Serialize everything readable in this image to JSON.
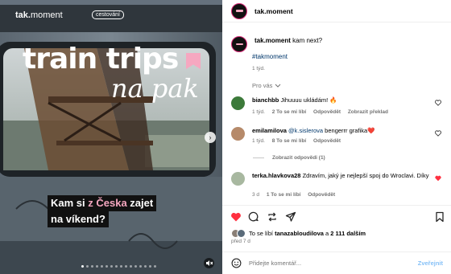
{
  "media": {
    "watermark_a": "tak.",
    "watermark_b": "moment",
    "tag": "cestování",
    "title_line1": "train trips",
    "title_line2": "na pak",
    "caption_part1": "Kam si ",
    "caption_highlight": "z Česka",
    "caption_part2": " zajet",
    "caption_line2": "na víkend?",
    "next_glyph": "›",
    "icons": [
      "bookmark-shape",
      "chevron-right-icon",
      "mute-icon"
    ]
  },
  "header": {
    "username": "tak.moment"
  },
  "post_caption": {
    "username": "tak.moment",
    "text": "kam next?",
    "hashtag": "#takmoment",
    "time": "1 týd."
  },
  "for_you": "Pro vás",
  "comments": [
    {
      "username": "bianchbb",
      "text": "Jihuuuu ukládám! 🔥",
      "time": "1 týd.",
      "likes": "2 To se mi líbí",
      "reply": "Odpovědět",
      "extra": "Zobrazit překlad",
      "liked": false
    },
    {
      "username": "emilamilova",
      "mention": "@k.sislerova",
      "text": " bengerrr grafika❤️",
      "time": "1 týd.",
      "likes": "8 To se mi líbí",
      "reply": "Odpovědět",
      "liked": false
    },
    {
      "username": "terka.hlavkova28",
      "text": "Zdravím, jaký je nejlepší spoj do Wroclavi. Díky",
      "time": "3 d",
      "likes": "1 To se mi líbí",
      "reply": "Odpovědět",
      "liked": true
    }
  ],
  "view_replies": "Zobrazit odpovědi (1)",
  "likes_line": {
    "prefix": "To se líbí ",
    "user": "tanazabloudilova",
    "middle": " a ",
    "count": "2 111 dalším"
  },
  "posted_ago": "před 7 d",
  "composer": {
    "placeholder": "Přidejte komentář...",
    "post_label": "Zveřejnit"
  },
  "colors": {
    "accent_pink": "#f6a7c0",
    "like_red": "#ff3040",
    "link_blue": "#00376b"
  }
}
